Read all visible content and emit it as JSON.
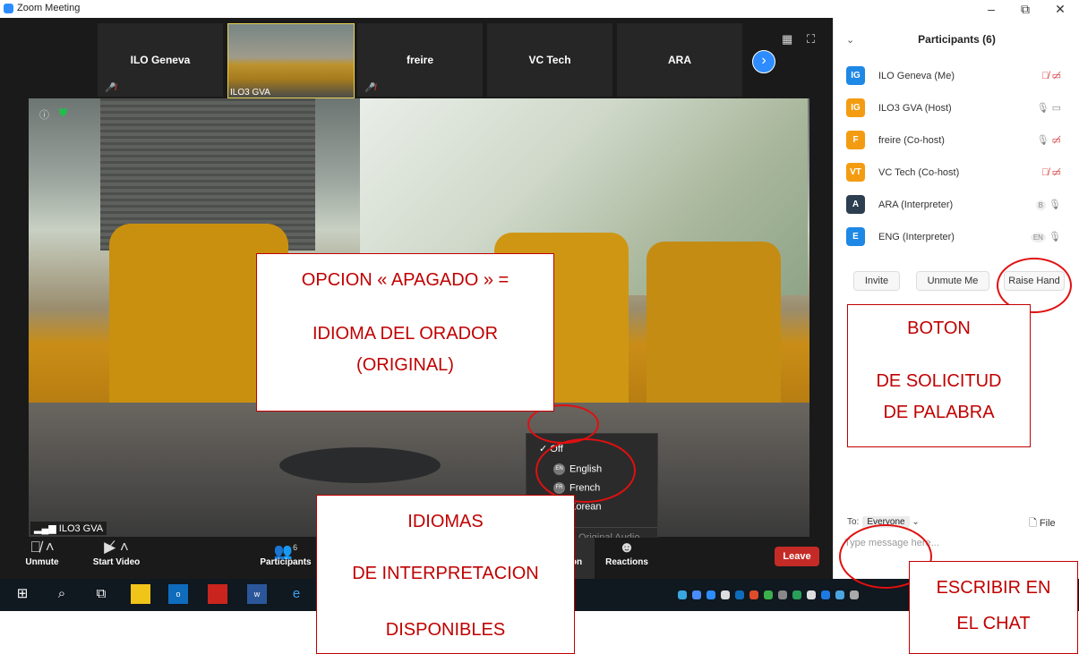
{
  "window": {
    "title": "Zoom Meeting",
    "minimize": "–",
    "restore": "⧉",
    "close": "✕"
  },
  "thumbs": [
    {
      "name": "ILO Geneva"
    },
    {
      "name": "ILO3 GVA"
    },
    {
      "name": "freire"
    },
    {
      "name": "VC Tech"
    },
    {
      "name": "ARA"
    }
  ],
  "video": {
    "label": "ILO3 GVA"
  },
  "toolbar": {
    "unmute": "Unmute",
    "start_video": "Start Video",
    "participants": "Participants",
    "participants_count": "6",
    "interpretation_partial": "on",
    "reactions": "Reactions",
    "leave": "Leave"
  },
  "language_menu": {
    "off": "Off",
    "options": [
      {
        "code": "EN",
        "label": "English"
      },
      {
        "code": "FR",
        "label": "French"
      },
      {
        "code": "KO",
        "label": "Korean"
      }
    ],
    "mute_original": "Original Audio"
  },
  "panel": {
    "title": "Participants (6)",
    "participants": [
      {
        "initials": "IG",
        "name": "ILO Geneva (Me)",
        "color": "#1e88e5",
        "icons": "mic-muted video-off"
      },
      {
        "initials": "IG",
        "name": "ILO3 GVA (Host)",
        "color": "#f39c12",
        "icons": "mic video"
      },
      {
        "initials": "F",
        "name": "freire (Co-host)",
        "color": "#f39c12",
        "icons": "mic video-off"
      },
      {
        "initials": "VT",
        "name": "VC Tech (Co-host)",
        "color": "#f39c12",
        "icons": "mic-muted video-off"
      },
      {
        "initials": "A",
        "name": "ARA (Interpreter)",
        "color": "#2c3e50",
        "badge": "B",
        "icons": "mic"
      },
      {
        "initials": "E",
        "name": "ENG (Interpreter)",
        "color": "#1e88e5",
        "badge": "EN",
        "icons": "mic"
      }
    ],
    "buttons": {
      "invite": "Invite",
      "unmute_me": "Unmute Me",
      "raise_hand": "Raise Hand"
    },
    "chat": {
      "to_label": "To:",
      "to_value": "Everyone",
      "file": "File",
      "placeholder": "Type message here..."
    }
  },
  "annotations": {
    "off_option": [
      "OPCION « APAGADO » =",
      "IDIOMA DEL ORADOR",
      "(ORIGINAL)"
    ],
    "raise_hand": [
      "BOTON",
      "DE SOLICITUD",
      "DE PALABRA"
    ],
    "languages": [
      "IDIOMAS",
      "DE INTERPRETACION",
      "DISPONIBLES"
    ],
    "chat": [
      "ESCRIBIR EN",
      "EL CHAT"
    ]
  }
}
